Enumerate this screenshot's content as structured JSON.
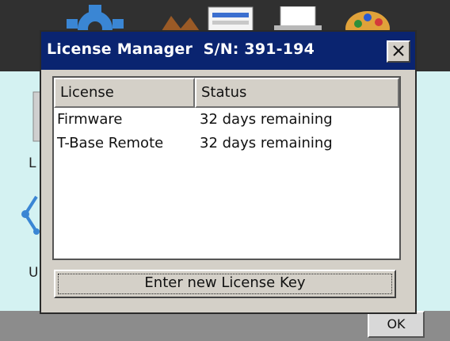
{
  "background": {
    "left_letters": [
      "L",
      "U"
    ],
    "ok_button_label": "OK",
    "icons": [
      "gear-icon",
      "tools-icon",
      "form-icon",
      "printer-icon",
      "palette-icon",
      "document-icon",
      "network-icon"
    ]
  },
  "dialog": {
    "title": "License Manager  S/N: 391-194",
    "close_icon": "close-icon",
    "columns": {
      "license": "License",
      "status": "Status"
    },
    "rows": [
      {
        "license": "Firmware",
        "status": "32 days remaining"
      },
      {
        "license": "T-Base Remote",
        "status": "32 days remaining"
      }
    ],
    "enter_key_label": "Enter new License Key"
  },
  "colors": {
    "title_bar": "#0a2470",
    "dialog_face": "#d4d0c8",
    "desktop": "#d4f2f2",
    "taskbar_top": "#303030"
  }
}
